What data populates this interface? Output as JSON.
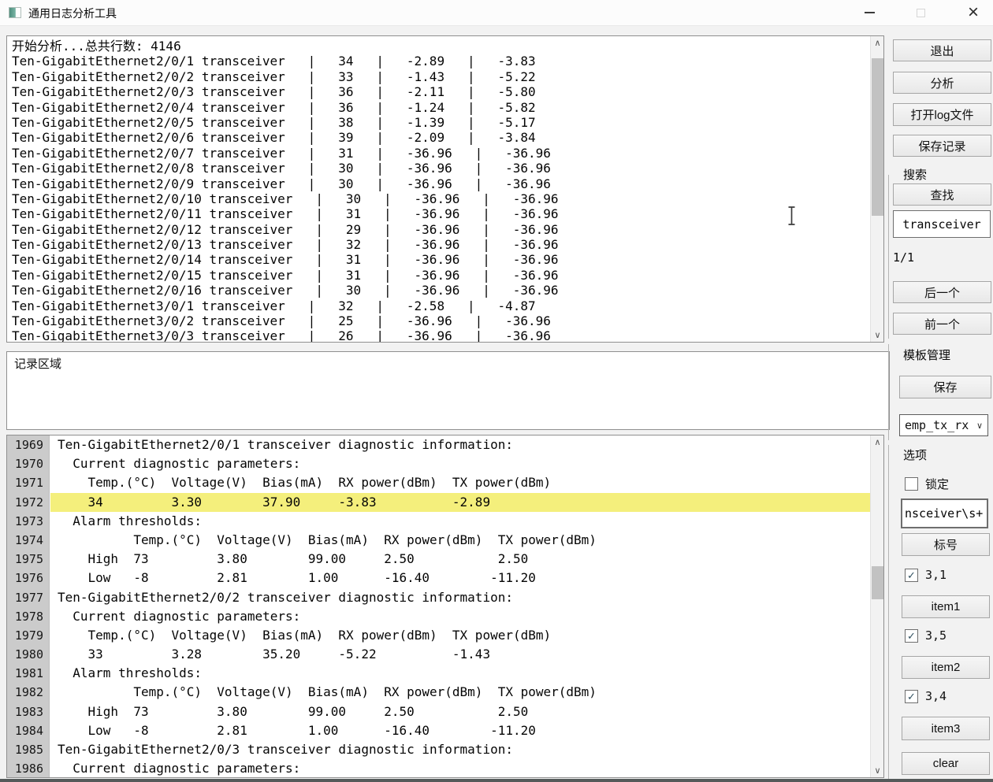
{
  "window": {
    "title": "通用日志分析工具"
  },
  "top_log": {
    "intro_line": "开始分析...总共行数: 4146",
    "columns": [
      "port",
      "temp",
      "tx_power_dbm",
      "rx_power_dbm"
    ],
    "rows": [
      {
        "port": "Ten-GigabitEthernet2/0/1",
        "temp": "34",
        "tx": "-2.89",
        "rx": "-3.83"
      },
      {
        "port": "Ten-GigabitEthernet2/0/2",
        "temp": "33",
        "tx": "-1.43",
        "rx": "-5.22"
      },
      {
        "port": "Ten-GigabitEthernet2/0/3",
        "temp": "36",
        "tx": "-2.11",
        "rx": "-5.80"
      },
      {
        "port": "Ten-GigabitEthernet2/0/4",
        "temp": "36",
        "tx": "-1.24",
        "rx": "-5.82"
      },
      {
        "port": "Ten-GigabitEthernet2/0/5",
        "temp": "38",
        "tx": "-1.39",
        "rx": "-5.17"
      },
      {
        "port": "Ten-GigabitEthernet2/0/6",
        "temp": "39",
        "tx": "-2.09",
        "rx": "-3.84"
      },
      {
        "port": "Ten-GigabitEthernet2/0/7",
        "temp": "31",
        "tx": "-36.96",
        "rx": "-36.96"
      },
      {
        "port": "Ten-GigabitEthernet2/0/8",
        "temp": "30",
        "tx": "-36.96",
        "rx": "-36.96"
      },
      {
        "port": "Ten-GigabitEthernet2/0/9",
        "temp": "30",
        "tx": "-36.96",
        "rx": "-36.96"
      },
      {
        "port": "Ten-GigabitEthernet2/0/10",
        "temp": "30",
        "tx": "-36.96",
        "rx": "-36.96"
      },
      {
        "port": "Ten-GigabitEthernet2/0/11",
        "temp": "31",
        "tx": "-36.96",
        "rx": "-36.96"
      },
      {
        "port": "Ten-GigabitEthernet2/0/12",
        "temp": "29",
        "tx": "-36.96",
        "rx": "-36.96"
      },
      {
        "port": "Ten-GigabitEthernet2/0/13",
        "temp": "32",
        "tx": "-36.96",
        "rx": "-36.96"
      },
      {
        "port": "Ten-GigabitEthernet2/0/14",
        "temp": "31",
        "tx": "-36.96",
        "rx": "-36.96"
      },
      {
        "port": "Ten-GigabitEthernet2/0/15",
        "temp": "31",
        "tx": "-36.96",
        "rx": "-36.96"
      },
      {
        "port": "Ten-GigabitEthernet2/0/16",
        "temp": "30",
        "tx": "-36.96",
        "rx": "-36.96"
      },
      {
        "port": "Ten-GigabitEthernet3/0/1",
        "temp": "32",
        "tx": "-2.58",
        "rx": "-4.87"
      },
      {
        "port": "Ten-GigabitEthernet3/0/2",
        "temp": "25",
        "tx": "-36.96",
        "rx": "-36.96"
      },
      {
        "port": "Ten-GigabitEthernet3/0/3",
        "temp": "26",
        "tx": "-36.96",
        "rx": "-36.96"
      }
    ]
  },
  "record_area": {
    "text": "记录区域"
  },
  "detail_log": {
    "highlight_line_no": 1972,
    "lines": [
      {
        "no": 1969,
        "text": "Ten-GigabitEthernet2/0/1 transceiver diagnostic information:"
      },
      {
        "no": 1970,
        "text": "  Current diagnostic parameters:"
      },
      {
        "no": 1971,
        "text": "    Temp.(°C)  Voltage(V)  Bias(mA)  RX power(dBm)  TX power(dBm)"
      },
      {
        "no": 1972,
        "text": "    34         3.30        37.90     -3.83          -2.89"
      },
      {
        "no": 1973,
        "text": "  Alarm thresholds:"
      },
      {
        "no": 1974,
        "text": "          Temp.(°C)  Voltage(V)  Bias(mA)  RX power(dBm)  TX power(dBm)"
      },
      {
        "no": 1975,
        "text": "    High  73         3.80        99.00     2.50           2.50"
      },
      {
        "no": 1976,
        "text": "    Low   -8         2.81        1.00      -16.40        -11.20"
      },
      {
        "no": 1977,
        "text": "Ten-GigabitEthernet2/0/2 transceiver diagnostic information:"
      },
      {
        "no": 1978,
        "text": "  Current diagnostic parameters:"
      },
      {
        "no": 1979,
        "text": "    Temp.(°C)  Voltage(V)  Bias(mA)  RX power(dBm)  TX power(dBm)"
      },
      {
        "no": 1980,
        "text": "    33         3.28        35.20     -5.22          -1.43"
      },
      {
        "no": 1981,
        "text": "  Alarm thresholds:"
      },
      {
        "no": 1982,
        "text": "          Temp.(°C)  Voltage(V)  Bias(mA)  RX power(dBm)  TX power(dBm)"
      },
      {
        "no": 1983,
        "text": "    High  73         3.80        99.00     2.50           2.50"
      },
      {
        "no": 1984,
        "text": "    Low   -8         2.81        1.00      -16.40        -11.20"
      },
      {
        "no": 1985,
        "text": "Ten-GigabitEthernet2/0/3 transceiver diagnostic information:"
      },
      {
        "no": 1986,
        "text": "  Current diagnostic parameters:"
      }
    ]
  },
  "sidebar": {
    "exit_label": "退出",
    "analyze_label": "分析",
    "open_log_label": "打开log文件",
    "save_record_label": "保存记录",
    "search_section_label": "搜索",
    "find_label": "查找",
    "search_value": "transceiver",
    "match_position": "1/1",
    "next_label": "后一个",
    "prev_label": "前一个",
    "template_section_label": "模板管理",
    "template_save_label": "保存",
    "template_selected": "emp_tx_rx",
    "options_section_label": "选项",
    "lock_label": "锁定",
    "lock_checked": false,
    "regex_value": "nsceiver\\s+",
    "mark_label": "标号",
    "checks": [
      {
        "label": "3,1",
        "checked": true
      },
      {
        "label": "3,5",
        "checked": true
      },
      {
        "label": "3,4",
        "checked": true
      }
    ],
    "item1_label": "item1",
    "item2_label": "item2",
    "item3_label": "item3",
    "clear_label": "clear"
  },
  "colors": {
    "highlight_row": "#f4ef7c",
    "gutter_bg": "#cbcbcb",
    "app_icon_teal": "#4e8f7e"
  }
}
